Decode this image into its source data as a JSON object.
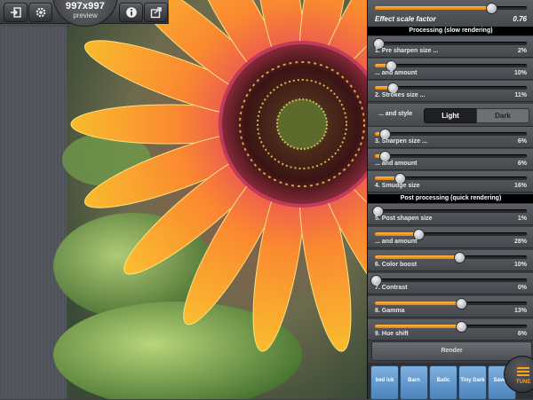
{
  "toolbar": {
    "preview_size": "997x997",
    "preview_label": "preview",
    "icons": [
      "import-icon",
      "gear-icon",
      "info-icon",
      "share-icon"
    ]
  },
  "panel": {
    "effect_scale": {
      "label": "Effect scale factor",
      "value": "0.76",
      "level": 0.76
    },
    "section_processing": "Processing (slow rendering)",
    "section_post": "Post processing (quick rendering)",
    "sliders_processing": [
      {
        "label": "1. Pre sharpen size ...",
        "value": "2%",
        "level": 0.02
      },
      {
        "label": "... and amount",
        "value": "10%",
        "level": 0.1
      },
      {
        "label": "2. Strokes size ...",
        "value": "11%",
        "level": 0.11
      }
    ],
    "style_label": "... and style",
    "style_options": [
      "Light",
      "Dark"
    ],
    "sliders_processing_2": [
      {
        "label": "3. Sharpen size ...",
        "value": "6%",
        "level": 0.06
      },
      {
        "label": "... and amount",
        "value": "6%",
        "level": 0.06
      },
      {
        "label": "4. Smudge size",
        "value": "16%",
        "level": 0.16
      }
    ],
    "sliders_post": [
      {
        "label": "5. Post shapen size",
        "value": "1%",
        "level": 0.01
      },
      {
        "label": "... and amount",
        "value": "28%",
        "level": 0.28
      },
      {
        "label": "6. Color boost",
        "value": "10%",
        "level": 0.55
      },
      {
        "label": "7. Contrast",
        "value": "0%",
        "level": 0.0
      },
      {
        "label": "8. Gamma",
        "value": "13%",
        "level": 0.56
      },
      {
        "label": "9. Hue shift",
        "value": "6%",
        "level": 0.56
      }
    ],
    "render_label": "Render"
  },
  "presets": [
    {
      "label": "bed\nick"
    },
    {
      "label": "Barn"
    },
    {
      "label": "Batic"
    },
    {
      "label": "Tiny Dark"
    },
    {
      "label": "Save..."
    }
  ],
  "tune_label": "TUNE",
  "colors": {
    "accent": "#f0901a",
    "preset": "#5f96cc"
  }
}
